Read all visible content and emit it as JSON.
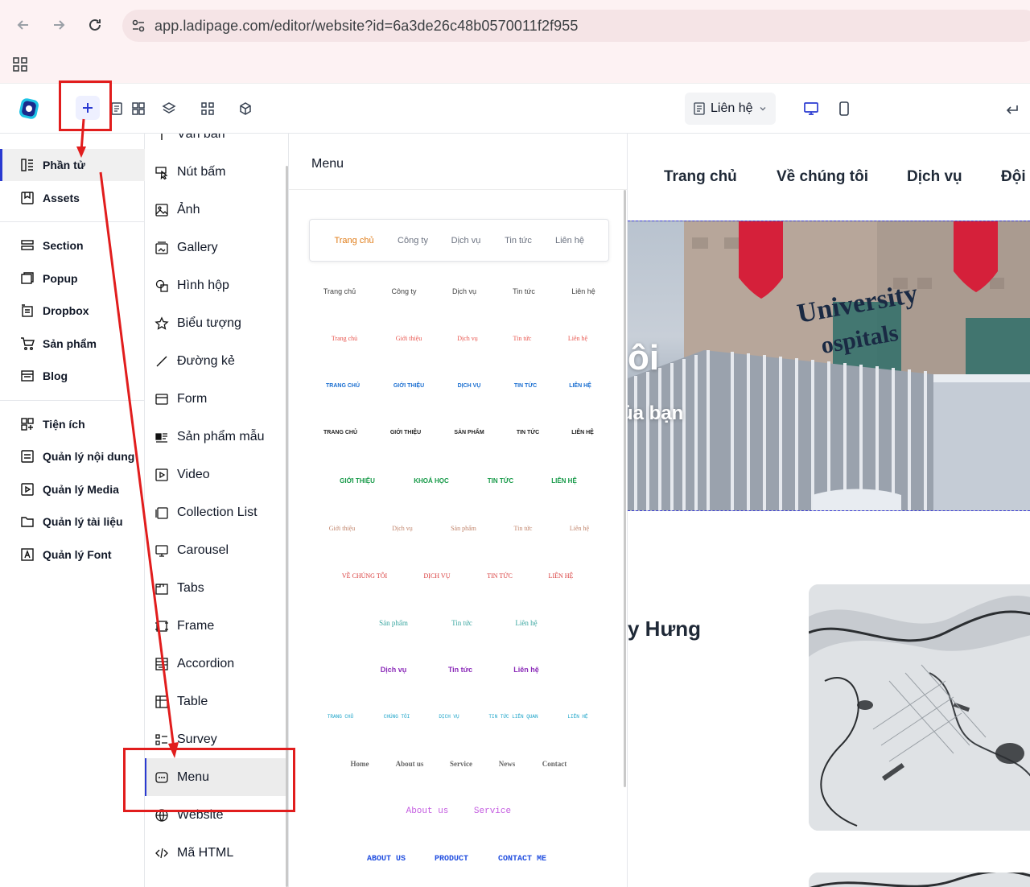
{
  "browser": {
    "url": "app.ladipage.com/editor/website?id=6a3de26c48b0570011f2f955"
  },
  "header": {
    "page_selector": "Liên hệ"
  },
  "sidebar": {
    "items": [
      {
        "label": "Phần tử",
        "active": true
      },
      {
        "label": "Assets"
      },
      {
        "label": "Section"
      },
      {
        "label": "Popup"
      },
      {
        "label": "Dropbox"
      },
      {
        "label": "Sản phẩm"
      },
      {
        "label": "Blog"
      },
      {
        "label": "Tiện ích"
      },
      {
        "label": "Quản lý nội dung"
      },
      {
        "label": "Quản lý Media"
      },
      {
        "label": "Quản lý tài liệu"
      },
      {
        "label": "Quản lý Font"
      }
    ]
  },
  "elements": {
    "items": [
      {
        "label": "Văn bản"
      },
      {
        "label": "Nút bấm"
      },
      {
        "label": "Ảnh"
      },
      {
        "label": "Gallery"
      },
      {
        "label": "Hình hộp"
      },
      {
        "label": "Biểu tượng"
      },
      {
        "label": "Đường kẻ"
      },
      {
        "label": "Form"
      },
      {
        "label": "Sản phẩm mẫu"
      },
      {
        "label": "Video"
      },
      {
        "label": "Collection List"
      },
      {
        "label": "Carousel"
      },
      {
        "label": "Tabs"
      },
      {
        "label": "Frame"
      },
      {
        "label": "Accordion"
      },
      {
        "label": "Table"
      },
      {
        "label": "Survey"
      },
      {
        "label": "Menu",
        "active": true
      },
      {
        "label": "Website"
      },
      {
        "label": "Mã HTML"
      }
    ]
  },
  "menu_panel": {
    "title": "Menu",
    "card": [
      "Trang chủ",
      "Công ty",
      "Dịch vụ",
      "Tin tức",
      "Liên hệ"
    ],
    "rows": [
      {
        "items": [
          "Trang chủ",
          "Công ty",
          "Dịch vụ",
          "Tin tức",
          "Liên hệ"
        ],
        "color": "#444444"
      },
      {
        "items": [
          "Trang chủ",
          "Giới thiệu",
          "Dịch vụ",
          "Tin tức",
          "Liên hệ"
        ],
        "color": "#e8554e"
      },
      {
        "items": [
          "TRANG CHỦ",
          "GIỚI THIỆU",
          "DỊCH VỤ",
          "TIN TỨC",
          "LIÊN HỆ"
        ],
        "color": "#1b6fd1"
      },
      {
        "items": [
          "TRANG CHỦ",
          "GIỚI THIỆU",
          "SẢN PHẨM",
          "TIN TỨC",
          "LIÊN HỆ"
        ],
        "color": "#222222"
      },
      {
        "items": [
          "GIỚI THIỆU",
          "KHOÁ HỌC",
          "TIN TỨC",
          "LIÊN HỆ"
        ],
        "color": "#159947"
      },
      {
        "items": [
          "Giới thiệu",
          "Dịch vụ",
          "Sản phẩm",
          "Tin tức",
          "Liên hệ"
        ],
        "color": "#c0836a"
      },
      {
        "items": [
          "VỀ CHÚNG TÔI",
          "DỊCH VỤ",
          "TIN TỨC",
          "LIÊN HỆ"
        ],
        "color": "#d93b3b"
      },
      {
        "items": [
          "Sản phẩm",
          "Tin tức",
          "Liên hệ"
        ],
        "color": "#3aa6a0"
      },
      {
        "items": [
          "Dịch vụ",
          "Tin tức",
          "Liên hệ"
        ],
        "color": "#8a2ab8"
      },
      {
        "items": [
          "TRANG CHỦ",
          "CHÚNG TÔI",
          "DỊCH VỤ",
          "TIN TỨC LIÊN QUAN",
          "LIÊN HỆ"
        ],
        "color": "#1aa3c8"
      },
      {
        "items": [
          "Home",
          "About us",
          "Service",
          "News",
          "Contact"
        ],
        "color": "#666666"
      },
      {
        "items": [
          "About us",
          "Service"
        ],
        "color": "#c45de0"
      },
      {
        "items": [
          "ABOUT US",
          "PRODUCT",
          "CONTACT ME"
        ],
        "color": "#2350e0"
      }
    ]
  },
  "canvas": {
    "nav": [
      "Trang chủ",
      "Về chúng tôi",
      "Dịch vụ",
      "Đội n"
    ],
    "hero_text_1": "ôi",
    "hero_text_2": "ủa bạn",
    "hero_sign": "University",
    "hero_sign_2": "ospitals",
    "section_text": "y Hưng"
  }
}
